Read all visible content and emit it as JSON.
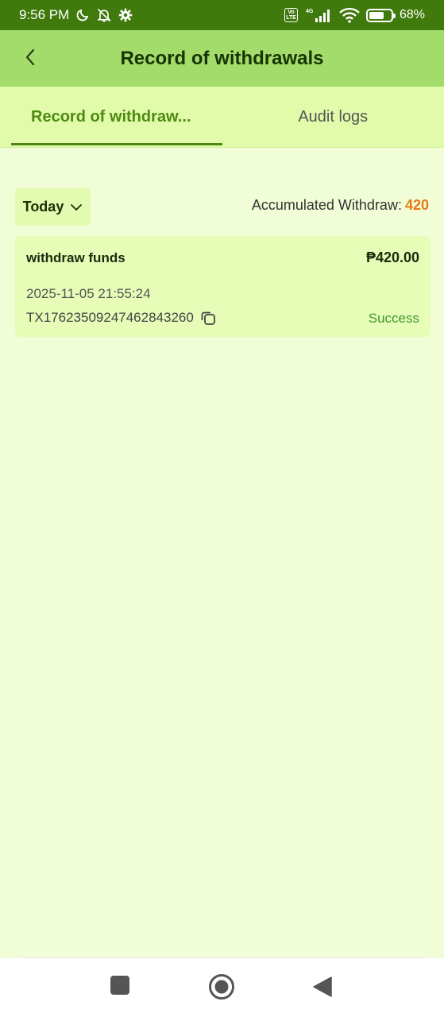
{
  "status_bar": {
    "time": "9:56 PM",
    "network": "4G",
    "volte": "Vo\nLTE",
    "battery_percent": "68",
    "battery_level": 0.68,
    "icons": [
      "moon-icon",
      "bell-off-icon",
      "gear-icon",
      "volte-icon",
      "signal-icon",
      "wifi-icon",
      "battery-icon"
    ]
  },
  "header": {
    "title": "Record of withdrawals"
  },
  "tabs": [
    {
      "label": "Record of withdraw...",
      "active": true
    },
    {
      "label": "Audit logs",
      "active": false
    }
  ],
  "filter": {
    "selected": "Today"
  },
  "summary": {
    "label": "Accumulated Withdraw:",
    "value": "420"
  },
  "records": [
    {
      "title": "withdraw funds",
      "amount": "₱420.00",
      "datetime": "2025-11-05 21:55:24",
      "txid": "TX17623509247462843260",
      "status": "Success"
    }
  ],
  "colors": {
    "status_bar": "#407a0d",
    "header": "#a4dc6b",
    "tabs_bg": "#e2fbab",
    "page_bg": "#f1fdd6",
    "card_bg": "#e7fcb7",
    "accent": "#4d8a11",
    "orange": "#e87a17",
    "success": "#3f9a2f"
  }
}
